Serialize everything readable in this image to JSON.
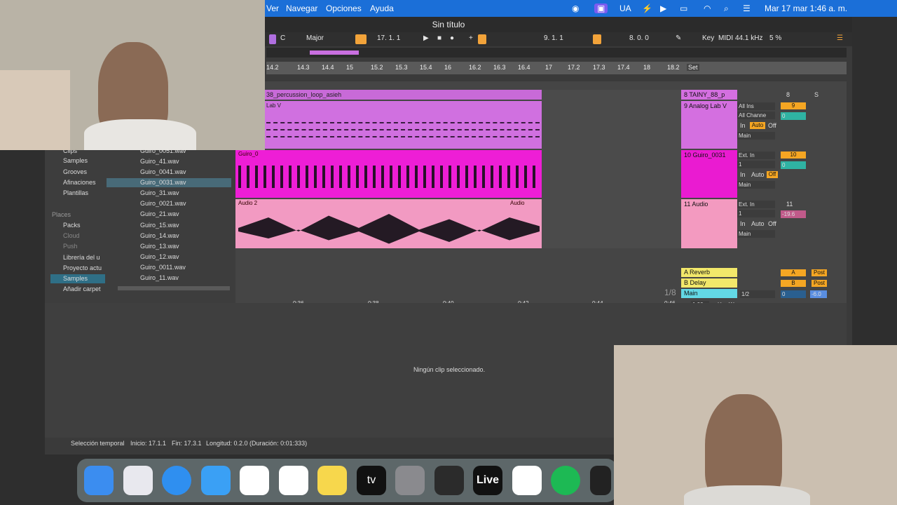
{
  "menubar": {
    "menus": [
      "Ver",
      "Navegar",
      "Opciones",
      "Ayuda"
    ],
    "input_source": "UA",
    "datetime": "Mar 17 mar  1:46 a. m."
  },
  "window": {
    "title": "Sin título"
  },
  "transport": {
    "key": "C",
    "scale": "Major",
    "position": "17.  1.  1",
    "loop_start": "9.  1.  1",
    "loop_length": "8.  0.  0",
    "key_label": "Key",
    "midi_label": "MIDI",
    "sample_rate": "44.1 kHz",
    "cpu": "5 %"
  },
  "ruler": {
    "ticks": [
      "14.2",
      "14.3",
      "14.4",
      "15",
      "15.2",
      "15.3",
      "15.4",
      "16",
      "16.2",
      "16.3",
      "16.4",
      "17",
      "17.2",
      "17.3",
      "17.4",
      "18",
      "18.2"
    ],
    "set_label": "Set"
  },
  "clips": {
    "top_clip": "38_percussion_loop_asieh",
    "lab_clip": "Lab V",
    "guiro_clip": "Guiro_0",
    "audio2_clip": "Audio 2",
    "audio_label": "Audio"
  },
  "tracks": [
    {
      "name": "8 TAINY_88_p",
      "num": "8",
      "color": "#d46fe0"
    },
    {
      "name": "9 Analog Lab V",
      "num": "9",
      "color": "#d46fe0"
    },
    {
      "name": "10 Guiro_0031",
      "num": "10",
      "color": "#ea1bd1"
    },
    {
      "name": "11 Audio",
      "num": "11",
      "color": "#f39ac0"
    },
    {
      "name": "A Reverb",
      "num": "A",
      "color": "#f2e86a"
    },
    {
      "name": "B Delay",
      "num": "B",
      "color": "#f2e86a"
    },
    {
      "name": "Main",
      "num": "0",
      "color": "#63d9e6"
    }
  ],
  "mixer": {
    "all_ins": "All Ins",
    "all_channels": "All Channe",
    "ext_in": "Ext. In",
    "in": "In",
    "auto": "Auto",
    "off": "Off",
    "main": "Main",
    "neg_inf": "-∞",
    "one": "1",
    "track11_vol": "-19.6",
    "main_vol": "-6.0",
    "post": "Post",
    "s": "S",
    "c": "C",
    "half": "1/2",
    "zero": "0",
    "quantize": "1/8",
    "zoom": "1.00x",
    "h": "H",
    "w": "W"
  },
  "timeline": {
    "times": [
      "0:36",
      "0:38",
      "0:40",
      "0:42",
      "0:44",
      "0:46"
    ]
  },
  "browser": {
    "categories": [
      "Clips",
      "Samples",
      "Grooves",
      "Afinaciones",
      "Plantillas"
    ],
    "places_header": "Places",
    "places": [
      "Packs",
      "Cloud",
      "Push",
      "Librería del u",
      "Proyecto actu",
      "Samples",
      "Añadir carpet"
    ],
    "files": [
      "Guiro_0051.wav",
      "Guiro_41.wav",
      "Guiro_0041.wav",
      "Guiro_0031.wav",
      "Guiro_31.wav",
      "Guiro_0021.wav",
      "Guiro_21.wav",
      "Guiro_15.wav",
      "Guiro_14.wav",
      "Guiro_13.wav",
      "Guiro_12.wav",
      "Guiro_0011.wav",
      "Guiro_11.wav"
    ]
  },
  "detail": {
    "empty_message": "Ningún clip seleccionado."
  },
  "status": {
    "mode": "Selección temporal",
    "start": "Inicio: 17.1.1",
    "end": "Fin: 17.3.1",
    "length": "Longitud: 0.2.0 (Duración: 0:01:333)"
  },
  "dock": {
    "apps": [
      "finder",
      "launchpad",
      "safari",
      "mail",
      "photos",
      "reminders",
      "notes",
      "apple-tv",
      "system-settings",
      "fl-studio",
      "live",
      "capcut",
      "spotify",
      "audio-app"
    ],
    "live_label": "Live",
    "tv_label": "tv"
  }
}
